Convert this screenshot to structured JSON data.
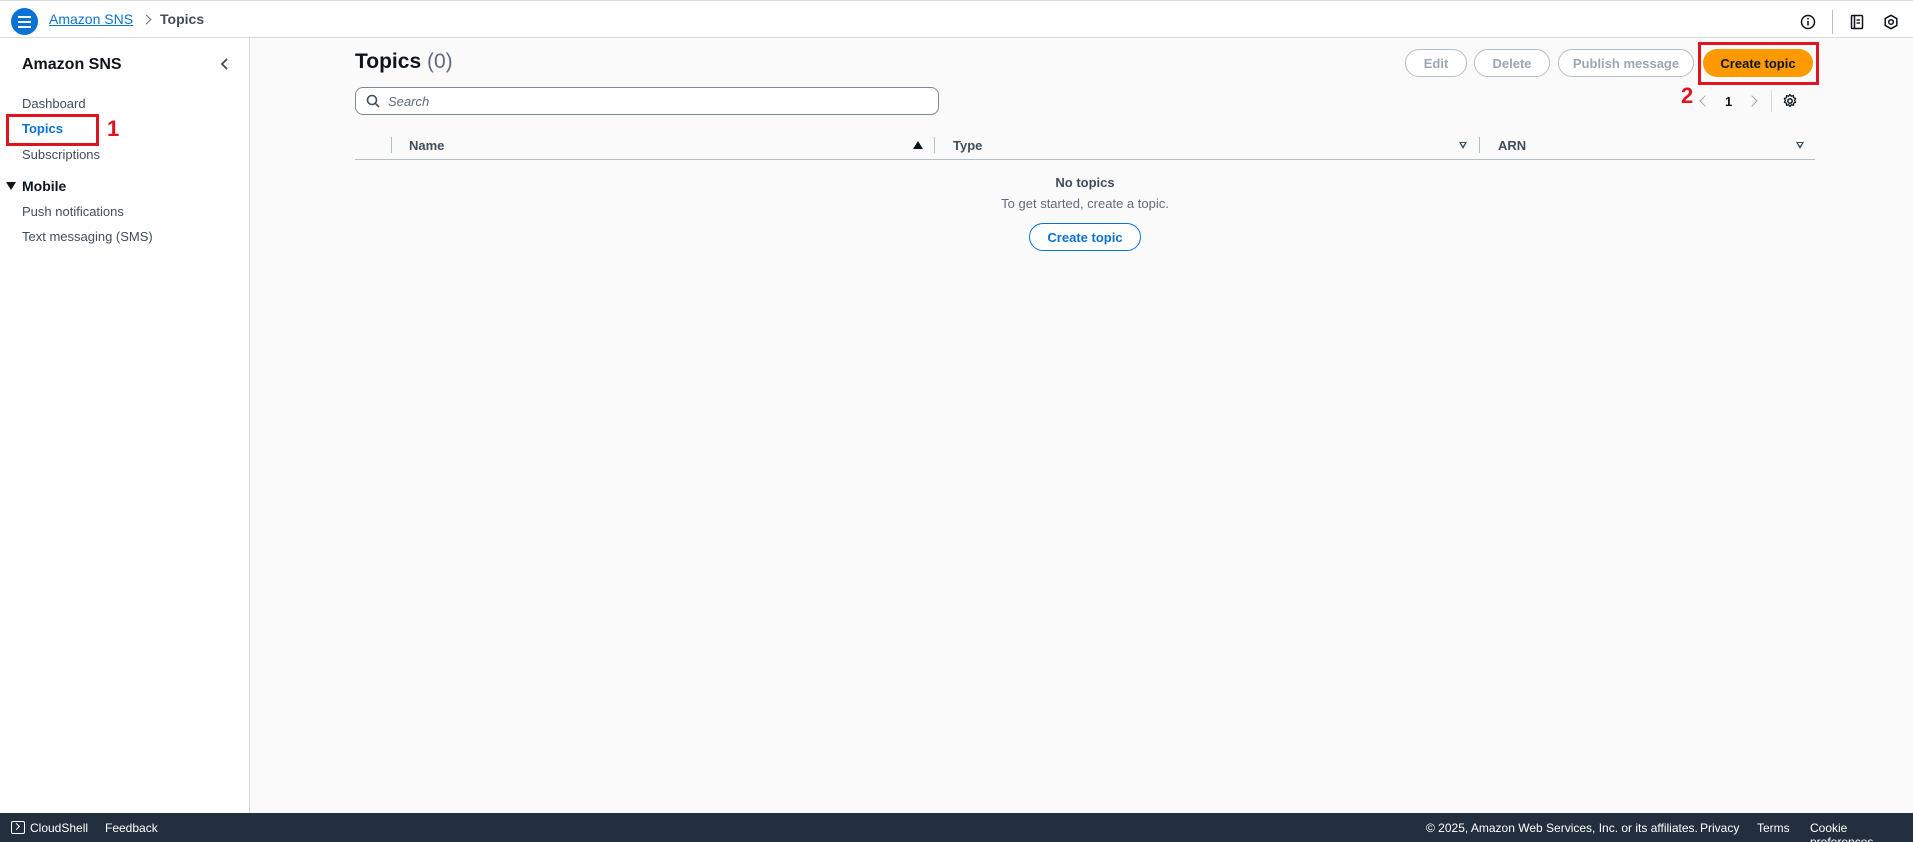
{
  "header": {
    "breadcrumbs": [
      {
        "label": "Amazon SNS"
      },
      {
        "label": "Topics"
      }
    ]
  },
  "sidebar": {
    "title": "Amazon SNS",
    "items": [
      {
        "label": "Dashboard"
      },
      {
        "label": "Topics",
        "active": true
      },
      {
        "label": "Subscriptions"
      }
    ],
    "section": {
      "label": "Mobile",
      "items": [
        {
          "label": "Push notifications"
        },
        {
          "label": "Text messaging (SMS)"
        }
      ]
    }
  },
  "main": {
    "title": "Topics",
    "count": "(0)",
    "actions": {
      "edit": "Edit",
      "delete": "Delete",
      "publish": "Publish message",
      "create": "Create topic"
    },
    "search": {
      "placeholder": "Search"
    },
    "pagination": {
      "current_page": "1"
    },
    "table": {
      "columns": [
        "Name",
        "Type",
        "ARN"
      ],
      "empty_title": "No topics",
      "empty_subtitle": "To get started, create a topic.",
      "empty_action": "Create topic"
    }
  },
  "annotations": {
    "step1": "1",
    "step2": "2",
    "color": "#e0141e"
  },
  "footer": {
    "cloudshell": "CloudShell",
    "feedback": "Feedback",
    "copyright": "© 2025, Amazon Web Services, Inc. or its affiliates.",
    "privacy": "Privacy",
    "terms": "Terms",
    "cookies": "Cookie preferences"
  },
  "colors": {
    "accent": "#0972d3",
    "primary_button": "#ff9900",
    "footer_bg": "#232f3e"
  }
}
